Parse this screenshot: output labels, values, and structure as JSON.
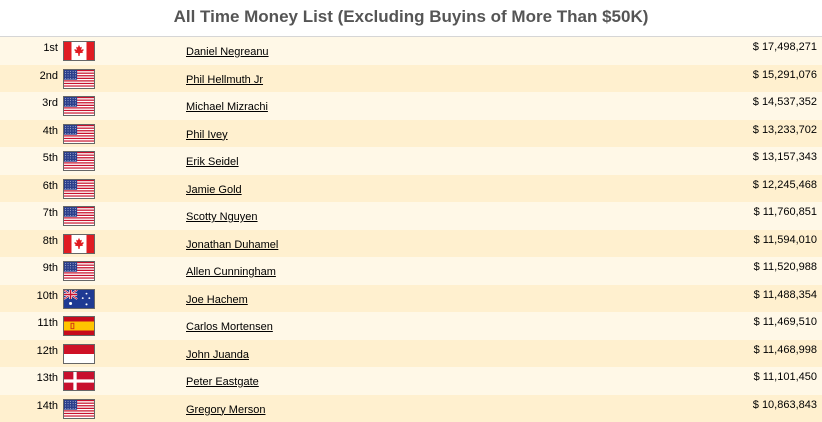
{
  "title": "All Time Money List (Excluding Buyins of More Than $50K)",
  "rows": [
    {
      "rank": "1st",
      "flag": "canada-flag-icon",
      "name": "Daniel Negreanu",
      "amount": "$ 17,498,271"
    },
    {
      "rank": "2nd",
      "flag": "usa-flag-icon",
      "name": "Phil Hellmuth Jr",
      "amount": "$ 15,291,076"
    },
    {
      "rank": "3rd",
      "flag": "usa-flag-icon",
      "name": "Michael Mizrachi",
      "amount": "$ 14,537,352"
    },
    {
      "rank": "4th",
      "flag": "usa-flag-icon",
      "name": "Phil Ivey",
      "amount": "$ 13,233,702"
    },
    {
      "rank": "5th",
      "flag": "usa-flag-icon",
      "name": "Erik Seidel",
      "amount": "$ 13,157,343"
    },
    {
      "rank": "6th",
      "flag": "usa-flag-icon",
      "name": "Jamie Gold",
      "amount": "$ 12,245,468"
    },
    {
      "rank": "7th",
      "flag": "usa-flag-icon",
      "name": "Scotty Nguyen",
      "amount": "$ 11,760,851"
    },
    {
      "rank": "8th",
      "flag": "canada-flag-icon",
      "name": "Jonathan Duhamel",
      "amount": "$ 11,594,010"
    },
    {
      "rank": "9th",
      "flag": "usa-flag-icon",
      "name": "Allen Cunningham",
      "amount": "$ 11,520,988"
    },
    {
      "rank": "10th",
      "flag": "australia-flag-icon",
      "name": "Joe Hachem",
      "amount": "$ 11,488,354"
    },
    {
      "rank": "11th",
      "flag": "spain-flag-icon",
      "name": "Carlos Mortensen",
      "amount": "$ 11,469,510"
    },
    {
      "rank": "12th",
      "flag": "indonesia-flag-icon",
      "name": "John Juanda",
      "amount": "$ 11,468,998"
    },
    {
      "rank": "13th",
      "flag": "denmark-flag-icon",
      "name": "Peter Eastgate",
      "amount": "$ 11,101,450"
    },
    {
      "rank": "14th",
      "flag": "usa-flag-icon",
      "name": "Gregory Merson",
      "amount": "$ 10,863,843"
    }
  ],
  "colors": {
    "row_odd": "#fff8e7",
    "row_even": "#fff0cf",
    "title": "#555555"
  }
}
